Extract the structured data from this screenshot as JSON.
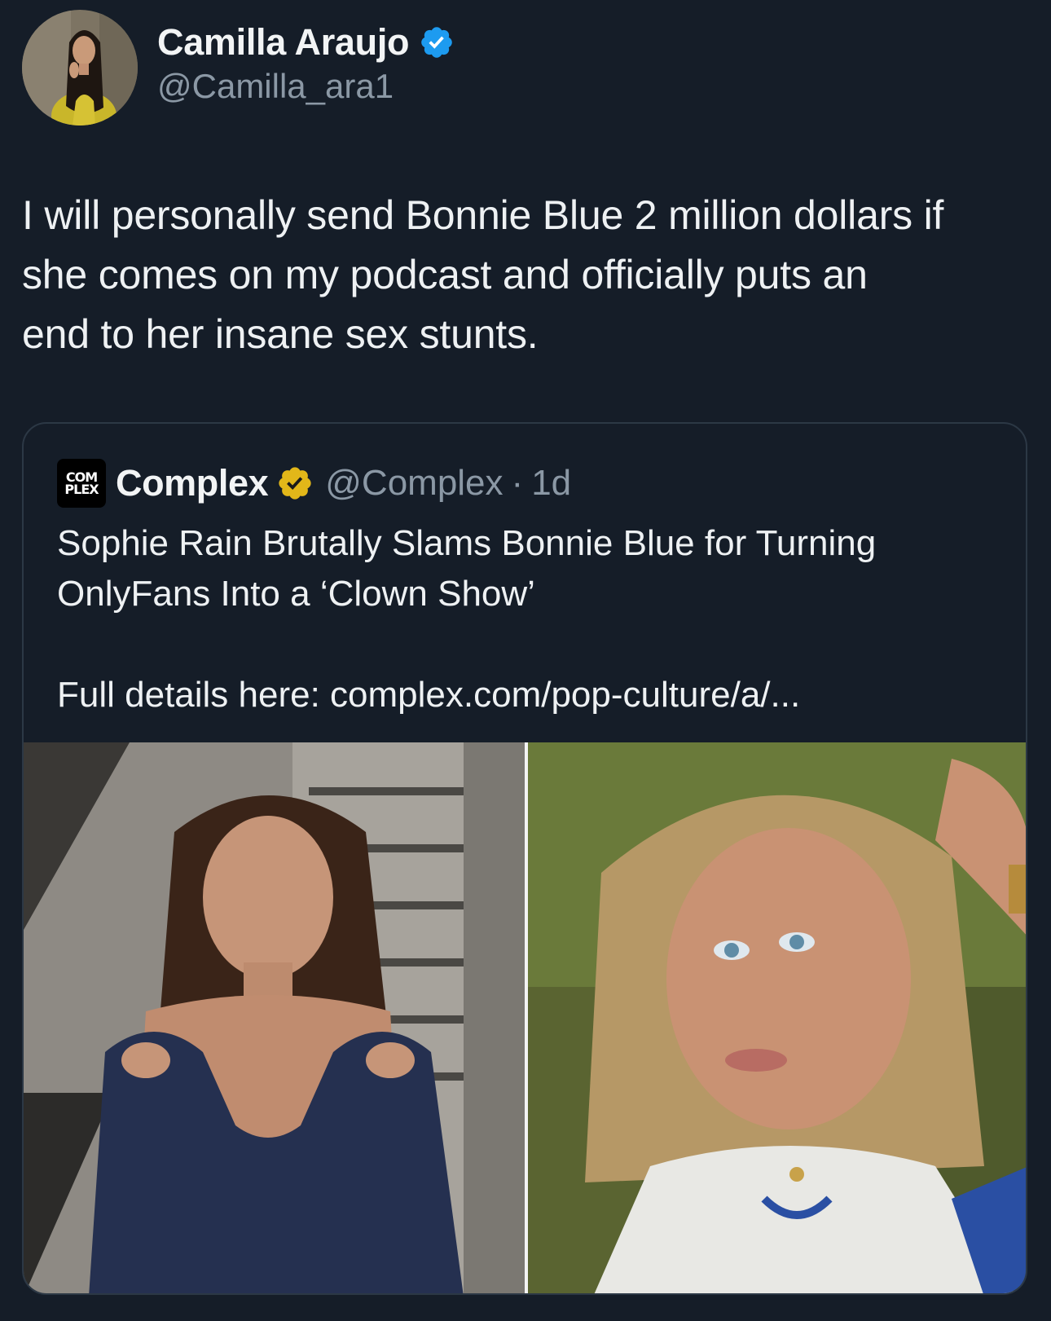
{
  "author": {
    "display_name": "Camilla Araujo",
    "handle": "@Camilla_ara1",
    "verified_icon": "blue-verified-badge"
  },
  "tweet": {
    "lines": [
      "I will personally send Bonnie Blue 2 million dollars if",
      "she comes on my podcast and officially puts an",
      "end to her insane sex stunts."
    ]
  },
  "quote": {
    "logo_line1": "COM",
    "logo_line2": "PLEX",
    "display_name": "Complex",
    "verified_icon": "gold-verified-badge",
    "handle": "@Complex",
    "separator": "·",
    "time": "1d",
    "headline_line1": "Sophie Rain Brutally Slams Bonnie Blue for Turning",
    "headline_line2": "OnlyFans Into a ‘Clown Show’",
    "details": "Full details here: complex.com/pop-culture/a/..."
  },
  "colors": {
    "background": "#151d28",
    "verified_blue": "#1d9bf0",
    "verified_gold": "#e2b719",
    "muted_text": "#8b98a5"
  }
}
